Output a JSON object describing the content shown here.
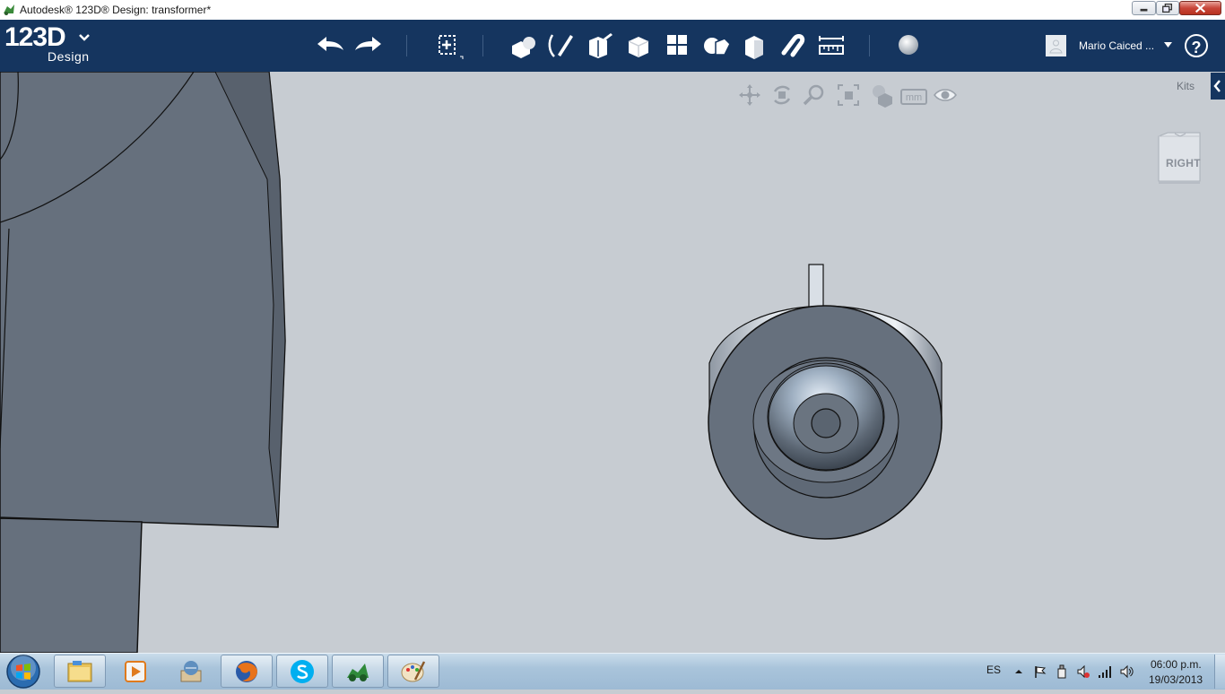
{
  "window": {
    "title": "Autodesk® 123D® Design: transformer*"
  },
  "app": {
    "logo_main": "123D",
    "logo_sub": "Design"
  },
  "toolbar": {
    "icons": [
      "undo-icon",
      "redo-icon",
      "transform-icon",
      "primitives-icon",
      "sketch-icon",
      "construct-icon",
      "modify-icon",
      "pattern-icon",
      "grouping-icon",
      "combine-icon",
      "snap-icon",
      "measure-icon",
      "material-icon"
    ],
    "user_name": "Mario Caiced ...",
    "help_label": "?"
  },
  "viewport": {
    "nav_icons": [
      "pan-icon",
      "orbit-icon",
      "zoom-icon",
      "fit-icon",
      "view-mode-icon",
      "units-icon",
      "visibility-icon"
    ],
    "units": "mm",
    "kits_label": "Kits",
    "viewcube_label": "RIGHT",
    "colors": {
      "background": "#c7ccd2",
      "model": "#66707d",
      "edge": "#111111"
    }
  },
  "taskbar": {
    "apps": [
      "windows-explorer-icon",
      "media-player-icon",
      "archive-icon",
      "firefox-icon",
      "skype-icon",
      "123d-design-icon",
      "paint-icon"
    ],
    "language": "ES",
    "time": "06:00 p.m.",
    "date": "19/03/2013"
  }
}
